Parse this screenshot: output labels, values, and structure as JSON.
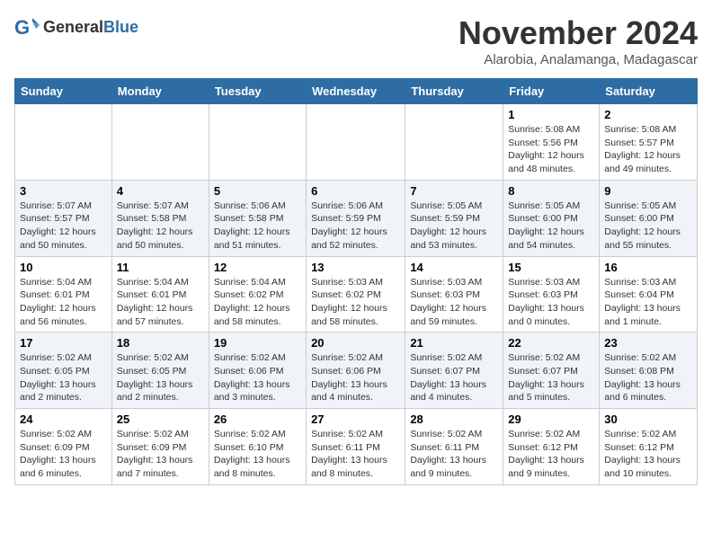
{
  "logo": {
    "general": "General",
    "blue": "Blue"
  },
  "title": "November 2024",
  "location": "Alarobia, Analamanga, Madagascar",
  "weekdays": [
    "Sunday",
    "Monday",
    "Tuesday",
    "Wednesday",
    "Thursday",
    "Friday",
    "Saturday"
  ],
  "weeks": [
    [
      {
        "day": "",
        "info": ""
      },
      {
        "day": "",
        "info": ""
      },
      {
        "day": "",
        "info": ""
      },
      {
        "day": "",
        "info": ""
      },
      {
        "day": "",
        "info": ""
      },
      {
        "day": "1",
        "info": "Sunrise: 5:08 AM\nSunset: 5:56 PM\nDaylight: 12 hours\nand 48 minutes."
      },
      {
        "day": "2",
        "info": "Sunrise: 5:08 AM\nSunset: 5:57 PM\nDaylight: 12 hours\nand 49 minutes."
      }
    ],
    [
      {
        "day": "3",
        "info": "Sunrise: 5:07 AM\nSunset: 5:57 PM\nDaylight: 12 hours\nand 50 minutes."
      },
      {
        "day": "4",
        "info": "Sunrise: 5:07 AM\nSunset: 5:58 PM\nDaylight: 12 hours\nand 50 minutes."
      },
      {
        "day": "5",
        "info": "Sunrise: 5:06 AM\nSunset: 5:58 PM\nDaylight: 12 hours\nand 51 minutes."
      },
      {
        "day": "6",
        "info": "Sunrise: 5:06 AM\nSunset: 5:59 PM\nDaylight: 12 hours\nand 52 minutes."
      },
      {
        "day": "7",
        "info": "Sunrise: 5:05 AM\nSunset: 5:59 PM\nDaylight: 12 hours\nand 53 minutes."
      },
      {
        "day": "8",
        "info": "Sunrise: 5:05 AM\nSunset: 6:00 PM\nDaylight: 12 hours\nand 54 minutes."
      },
      {
        "day": "9",
        "info": "Sunrise: 5:05 AM\nSunset: 6:00 PM\nDaylight: 12 hours\nand 55 minutes."
      }
    ],
    [
      {
        "day": "10",
        "info": "Sunrise: 5:04 AM\nSunset: 6:01 PM\nDaylight: 12 hours\nand 56 minutes."
      },
      {
        "day": "11",
        "info": "Sunrise: 5:04 AM\nSunset: 6:01 PM\nDaylight: 12 hours\nand 57 minutes."
      },
      {
        "day": "12",
        "info": "Sunrise: 5:04 AM\nSunset: 6:02 PM\nDaylight: 12 hours\nand 58 minutes."
      },
      {
        "day": "13",
        "info": "Sunrise: 5:03 AM\nSunset: 6:02 PM\nDaylight: 12 hours\nand 58 minutes."
      },
      {
        "day": "14",
        "info": "Sunrise: 5:03 AM\nSunset: 6:03 PM\nDaylight: 12 hours\nand 59 minutes."
      },
      {
        "day": "15",
        "info": "Sunrise: 5:03 AM\nSunset: 6:03 PM\nDaylight: 13 hours\nand 0 minutes."
      },
      {
        "day": "16",
        "info": "Sunrise: 5:03 AM\nSunset: 6:04 PM\nDaylight: 13 hours\nand 1 minute."
      }
    ],
    [
      {
        "day": "17",
        "info": "Sunrise: 5:02 AM\nSunset: 6:05 PM\nDaylight: 13 hours\nand 2 minutes."
      },
      {
        "day": "18",
        "info": "Sunrise: 5:02 AM\nSunset: 6:05 PM\nDaylight: 13 hours\nand 2 minutes."
      },
      {
        "day": "19",
        "info": "Sunrise: 5:02 AM\nSunset: 6:06 PM\nDaylight: 13 hours\nand 3 minutes."
      },
      {
        "day": "20",
        "info": "Sunrise: 5:02 AM\nSunset: 6:06 PM\nDaylight: 13 hours\nand 4 minutes."
      },
      {
        "day": "21",
        "info": "Sunrise: 5:02 AM\nSunset: 6:07 PM\nDaylight: 13 hours\nand 4 minutes."
      },
      {
        "day": "22",
        "info": "Sunrise: 5:02 AM\nSunset: 6:07 PM\nDaylight: 13 hours\nand 5 minutes."
      },
      {
        "day": "23",
        "info": "Sunrise: 5:02 AM\nSunset: 6:08 PM\nDaylight: 13 hours\nand 6 minutes."
      }
    ],
    [
      {
        "day": "24",
        "info": "Sunrise: 5:02 AM\nSunset: 6:09 PM\nDaylight: 13 hours\nand 6 minutes."
      },
      {
        "day": "25",
        "info": "Sunrise: 5:02 AM\nSunset: 6:09 PM\nDaylight: 13 hours\nand 7 minutes."
      },
      {
        "day": "26",
        "info": "Sunrise: 5:02 AM\nSunset: 6:10 PM\nDaylight: 13 hours\nand 8 minutes."
      },
      {
        "day": "27",
        "info": "Sunrise: 5:02 AM\nSunset: 6:11 PM\nDaylight: 13 hours\nand 8 minutes."
      },
      {
        "day": "28",
        "info": "Sunrise: 5:02 AM\nSunset: 6:11 PM\nDaylight: 13 hours\nand 9 minutes."
      },
      {
        "day": "29",
        "info": "Sunrise: 5:02 AM\nSunset: 6:12 PM\nDaylight: 13 hours\nand 9 minutes."
      },
      {
        "day": "30",
        "info": "Sunrise: 5:02 AM\nSunset: 6:12 PM\nDaylight: 13 hours\nand 10 minutes."
      }
    ]
  ]
}
